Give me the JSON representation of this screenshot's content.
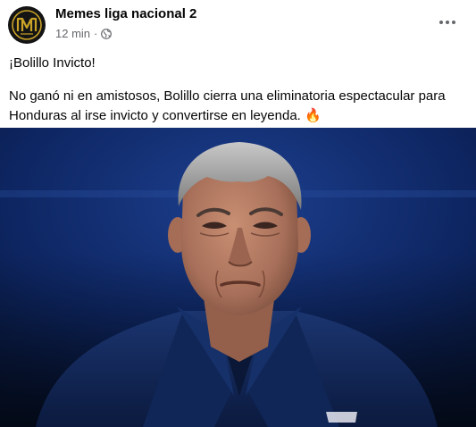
{
  "post": {
    "author": "Memes liga nacional 2",
    "time": "12 min",
    "separator": "·",
    "privacy_icon": "globe-icon",
    "more_icon": "more-options-icon",
    "avatar_icon": "page-logo-icon",
    "headline": "¡Bolillo Invicto!",
    "body": "No ganó ni en amistosos, Bolillo cierra una eliminatoria espectacular para Honduras al irse invicto y convertirse en leyenda. 🔥"
  },
  "colors": {
    "author": "#050505",
    "meta": "#65676b",
    "photo_background": "#0a1c4a",
    "jacket": "#142a5c",
    "logo_gold": "#c9a227"
  }
}
